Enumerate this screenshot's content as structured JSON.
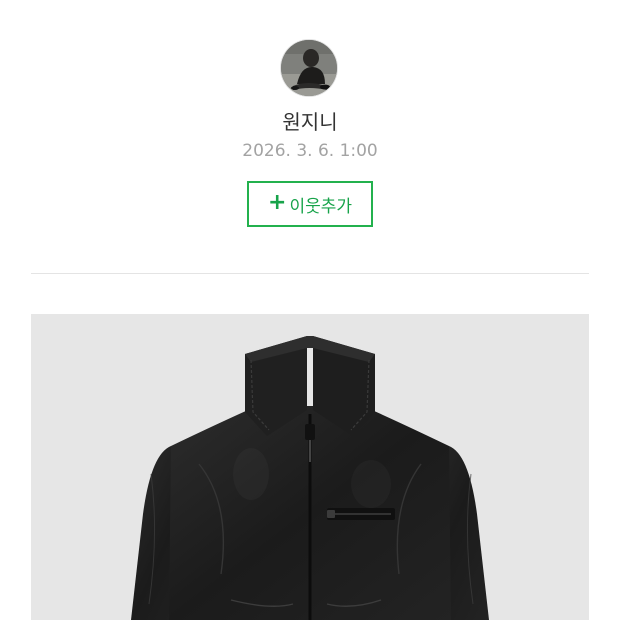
{
  "profile": {
    "author_name": "원지니",
    "post_date": "2026. 3. 6. 1:00",
    "add_neighbor": {
      "icon": "plus-icon",
      "label": "이웃추가"
    }
  },
  "colors": {
    "accent_green": "#23b14d",
    "name_text": "#333333",
    "date_text": "#a3a3a3",
    "divider": "#e4e4e4",
    "photo_background": "#e6e6e6"
  }
}
